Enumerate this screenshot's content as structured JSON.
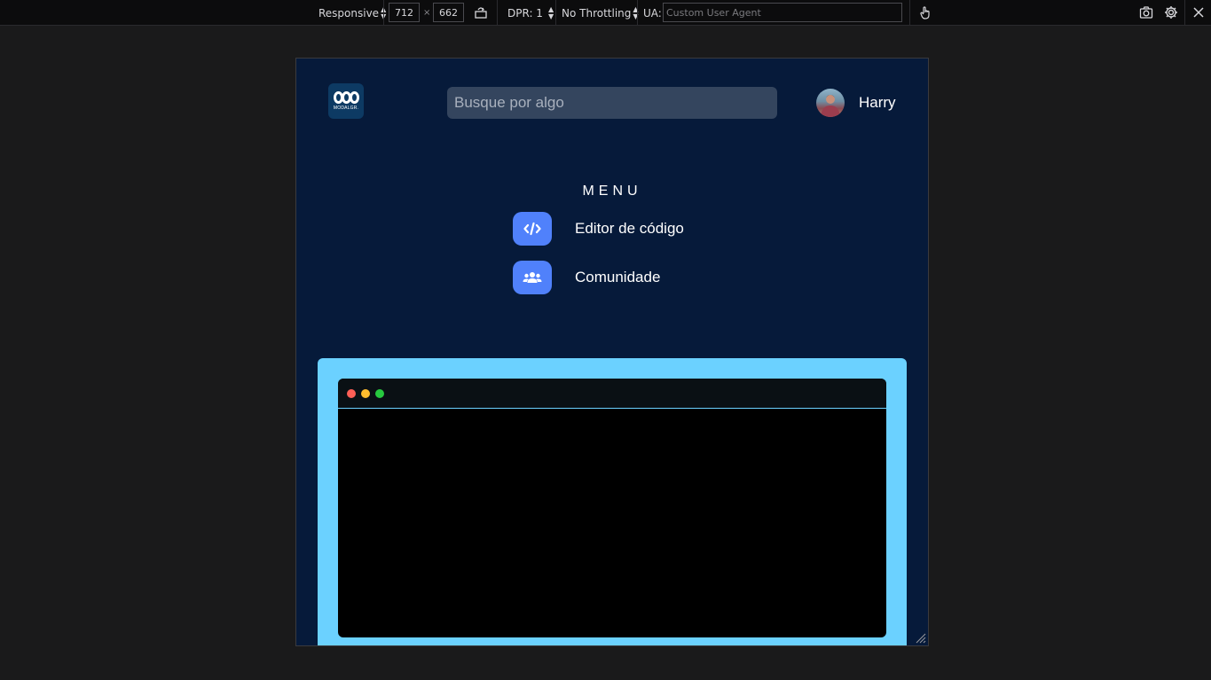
{
  "toolbar": {
    "device_label": "Responsive",
    "width_value": "712",
    "times": "×",
    "height_value": "662",
    "dpr_label": "DPR: 1",
    "throttling_label": "No Throttling",
    "ua_label": "UA:",
    "ua_placeholder": "Custom User Agent",
    "icons": [
      "rotate-icon",
      "touch-icon",
      "screenshot-icon",
      "settings-icon",
      "close-icon"
    ]
  },
  "site": {
    "logo_text": "MODALGR.",
    "search_placeholder": "Busque por algo",
    "user_name": "Harry",
    "menu_title": "MENU",
    "menu_items": [
      {
        "label": "Editor de código",
        "icon": "code-icon"
      },
      {
        "label": "Comunidade",
        "icon": "users-icon"
      }
    ],
    "editor_dots": [
      "#ff5f56",
      "#ffbd2e",
      "#27c93f"
    ],
    "accent_color": "#5081fb",
    "editor_border_color": "#6bd1ff",
    "background_color": "#061a3a"
  }
}
